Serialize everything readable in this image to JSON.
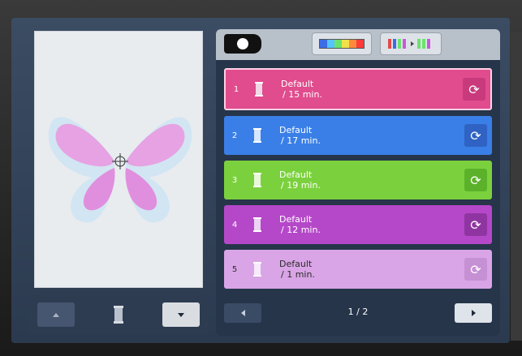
{
  "toolbar": {
    "palette_icon": "palette-icon",
    "color_bar_colors": [
      "#3b6de6",
      "#56c3ff",
      "#6be36b",
      "#f0e04a",
      "#ff8a3b",
      "#ff3b3b"
    ],
    "sort_icon": "color-sort-icon"
  },
  "rows": [
    {
      "num": "1",
      "line1": "Default",
      "line2": "/ 15 min.",
      "color": "#e04c8d",
      "btn": "#c83a7c"
    },
    {
      "num": "2",
      "line1": "Default",
      "line2": "/ 17 min.",
      "color": "#3a7fe7",
      "btn": "#2f62c2"
    },
    {
      "num": "3",
      "line1": "Default",
      "line2": "/ 19 min.",
      "color": "#7bd13d",
      "btn": "#5bb22a"
    },
    {
      "num": "4",
      "line1": "Default",
      "line2": "/ 12 min.",
      "color": "#b548c8",
      "btn": "#8f35a1"
    },
    {
      "num": "5",
      "line1": "Default",
      "line2": "/ 1 min.",
      "color": "#d9a5e6",
      "btn": "#c690d4"
    }
  ],
  "pager": {
    "text": "1 / 2"
  }
}
